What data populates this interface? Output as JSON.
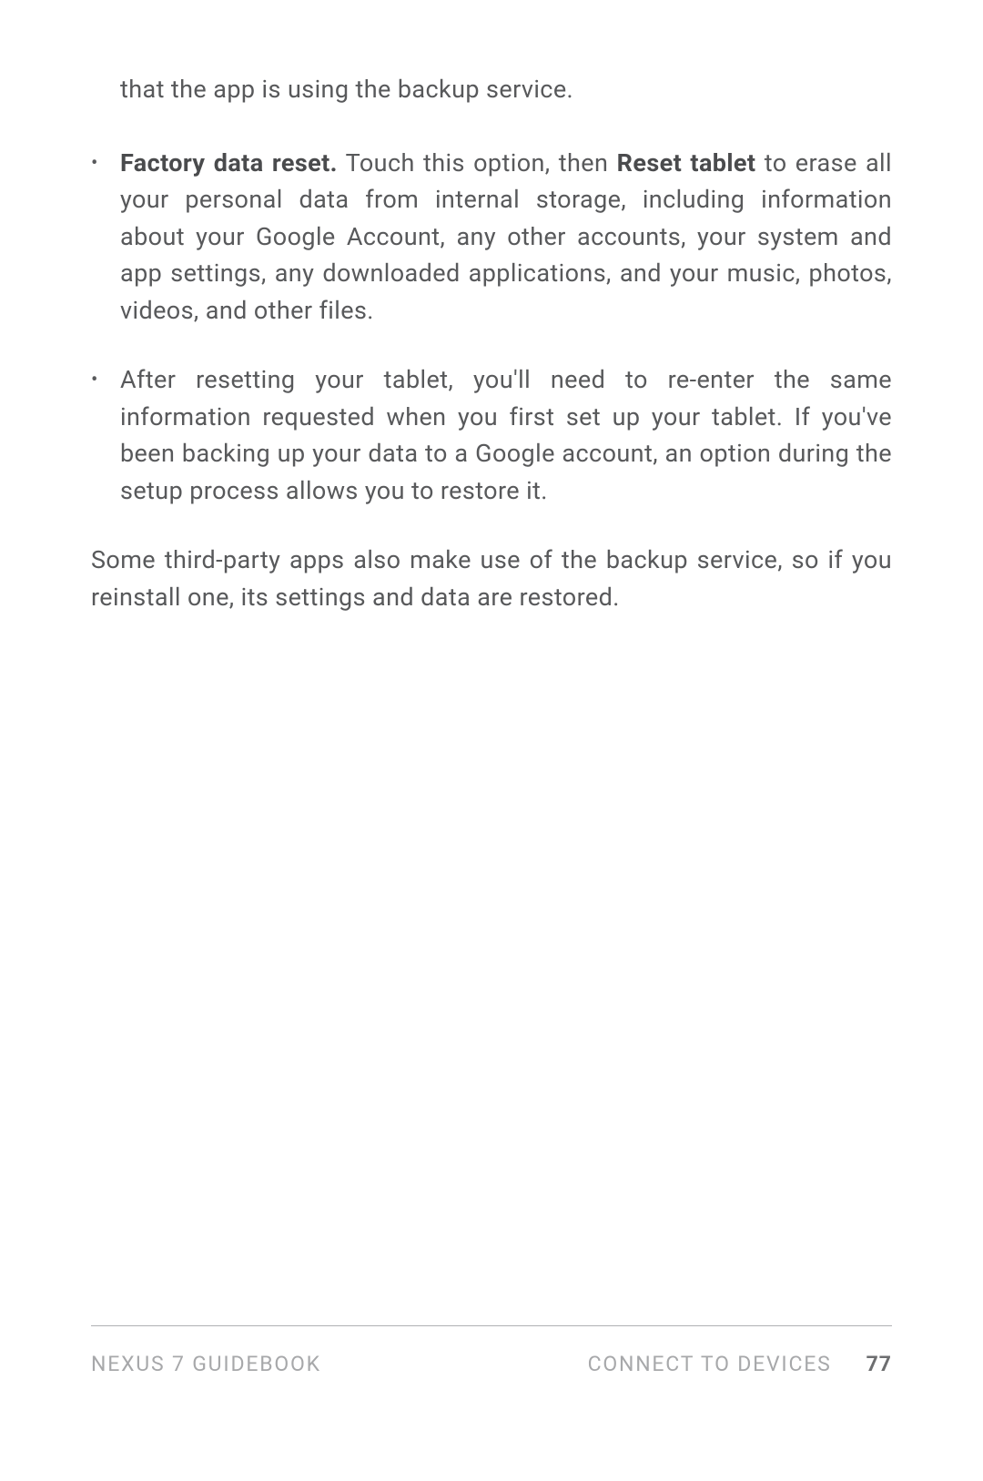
{
  "intro": "that the app is using the backup service.",
  "bullets": [
    {
      "bold1": "Factory data reset.",
      "mid": " Touch this option, then ",
      "bold2": "Reset tablet",
      "tail": " to erase all your personal data from internal storage, including information about your Google Account, any other accounts, your system and app settings, any downloaded applications, and your music, photos, videos, and other files."
    },
    {
      "text": "After resetting your tablet, you'll need to re-enter the same information requested when you first set up your tablet. If you've been backing up your data to a Google account, an option during the setup process allows you to restore it."
    }
  ],
  "closing": "Some third-party apps also make use of the backup service, so if you reinstall one, its settings and data are restored.",
  "footer": {
    "book": "NEXUS 7 GUIDEBOOK",
    "section": "CONNECT TO DEVICES",
    "page": "77"
  }
}
